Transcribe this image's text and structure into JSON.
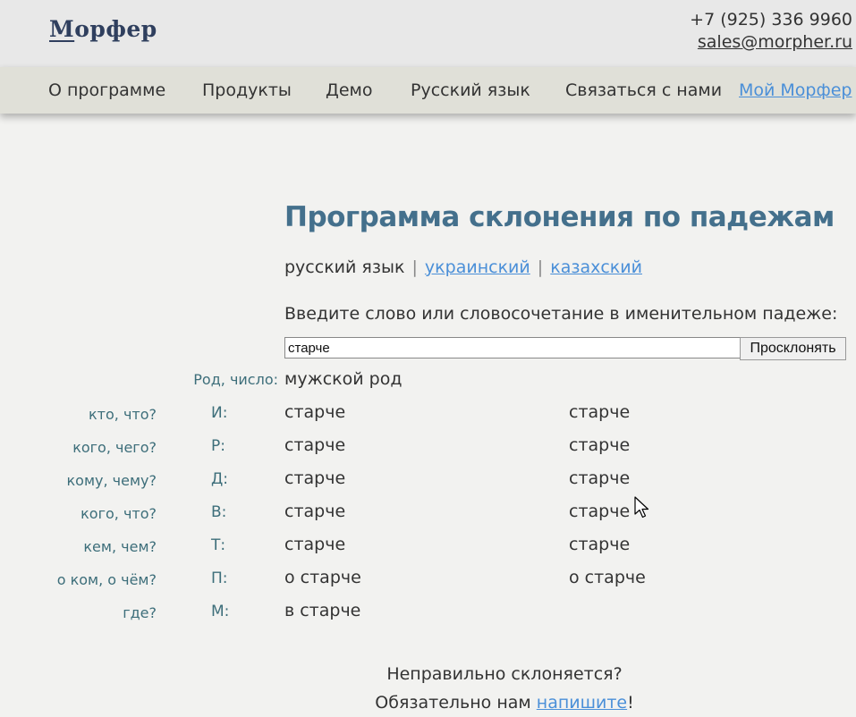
{
  "header": {
    "logo": "Морфер",
    "logo_first": "М",
    "logo_rest": "орфер",
    "phone": "+7 (925) 336 9960",
    "email": "sales@morpher.ru"
  },
  "nav": {
    "items": [
      "О программе",
      "Продукты",
      "Демо",
      "Русский язык",
      "Связаться с нами"
    ],
    "account_link": "Мой Морфер"
  },
  "main": {
    "title": "Программа склонения по падежам",
    "languages": {
      "current": "русский язык",
      "separator": "|",
      "links": [
        "украинский",
        "казахский"
      ]
    },
    "prompt": "Введите слово или словосочетание в именительном падеже:",
    "input_value": "старче",
    "submit_label": "Просклонять",
    "gender_label": "Род, число:",
    "gender_value": "мужской род"
  },
  "declension": {
    "rows": [
      {
        "question": "кто, что?",
        "case": "И:",
        "singular": "старче",
        "plural": "старче"
      },
      {
        "question": "кого, чего?",
        "case": "Р:",
        "singular": "старче",
        "plural": "старче"
      },
      {
        "question": "кому, чему?",
        "case": "Д:",
        "singular": "старче",
        "plural": "старче"
      },
      {
        "question": "кого, что?",
        "case": "В:",
        "singular": "старче",
        "plural": "старче"
      },
      {
        "question": "кем, чем?",
        "case": "Т:",
        "singular": "старче",
        "plural": "старче"
      },
      {
        "question": "о ком, о чём?",
        "case": "П:",
        "singular": "о старче",
        "plural": "о старче"
      },
      {
        "question": "где?",
        "case": "М:",
        "singular": "в старче",
        "plural": ""
      }
    ]
  },
  "footer": {
    "line1": "Неправильно склоняется?",
    "line2_before": "Обязательно нам",
    "line2_link": "напишите",
    "line2_after": "!"
  },
  "colors": {
    "background": "#f2f2f0",
    "title": "#44708c",
    "link": "#4a8fd8",
    "label": "#3d6e7a"
  }
}
